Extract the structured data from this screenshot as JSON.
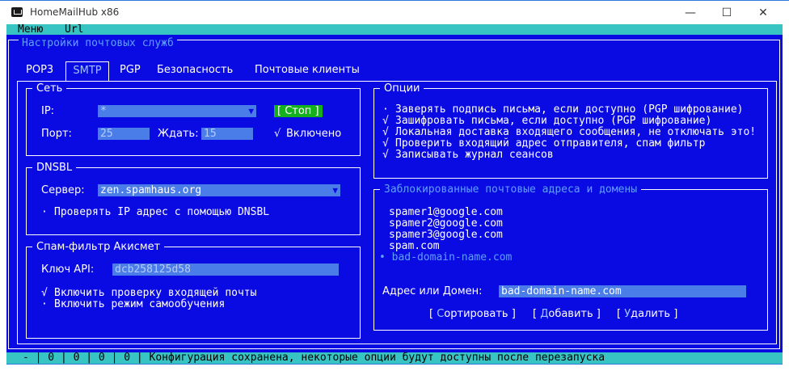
{
  "window": {
    "title": "HomeMailHub x86",
    "minimize_glyph": "—",
    "maximize_glyph": "☐",
    "close_glyph": "✕"
  },
  "menubar": {
    "items": [
      "Меню",
      "Url"
    ]
  },
  "main": {
    "title": "Настройки почтовых служб",
    "tabs": [
      {
        "label": "POP3",
        "active": false
      },
      {
        "label": "SMTP",
        "active": true
      },
      {
        "label": "PGP",
        "active": false
      },
      {
        "label": "Безопасность",
        "active": false
      },
      {
        "label": "Почтовые клиенты",
        "active": false
      }
    ]
  },
  "network": {
    "title": "Сеть",
    "ip_label": "IP:",
    "ip_value": "*",
    "stop_button": "[ Стоп ]",
    "port_label": "Порт:",
    "port_value": "25",
    "wait_label": "Ждать:",
    "wait_value": "15",
    "enabled_mark": "√",
    "enabled_label": "Включено"
  },
  "dnsbl": {
    "title": "DNSBL",
    "server_label": "Сервер:",
    "server_value": "zen.spamhaus.org",
    "check_mark": "·",
    "check_label": "Проверять IP адрес с помощью DNSBL"
  },
  "akismet": {
    "title": "Спам-фильтр Акисмет",
    "api_key_label": "Ключ API:",
    "api_key_value": "dcb258125d58",
    "options": [
      {
        "mark": "√",
        "label": "Включить проверку входящей почты"
      },
      {
        "mark": "·",
        "label": "Включить режим самообучения"
      }
    ]
  },
  "options": {
    "title": "Опции",
    "items": [
      {
        "mark": "·",
        "label": "Заверять подпись письма, если доступно (PGP шифрование)"
      },
      {
        "mark": "√",
        "label": "Зашифровать письма, если доступно (PGP шифрование)"
      },
      {
        "mark": "√",
        "label": "Локальная доставка входящего сообщения, не отключать это!"
      },
      {
        "mark": "√",
        "label": "Проверить входящий адрес отправителя, спам фильтр"
      },
      {
        "mark": "√",
        "label": "Записывать журнал сеансов"
      }
    ]
  },
  "blocked": {
    "title": "Заблокированные почтовые адреса и домены",
    "items": [
      "spamer1@google.com",
      "spamer2@google.com",
      "spamer3@google.com",
      "spam.com",
      "bad-domain-name.com"
    ],
    "selected_index": 4,
    "selected_marker": "•",
    "address_label": "Адрес или Домен:",
    "address_value": "bad-domain-name.com",
    "sort_button": {
      "open": "[ ",
      "hotkey": "С",
      "rest": "ортировать",
      "close": " ]"
    },
    "add_button": {
      "open": "[ ",
      "hotkey": "Д",
      "rest": "обавить",
      "close": " ]"
    },
    "delete_button": {
      "open": "[ ",
      "hotkey": "У",
      "rest": "далить",
      "close": " ]"
    }
  },
  "statusbar": {
    "text": "-  | 0 | 0 | 0 | 0 | Конфигурация сохранена, некоторые опции будут доступны после перезапуска"
  },
  "colors": {
    "background": "#0a0ae3",
    "menubar": "#39c4c4",
    "field": "#4a7de8",
    "dim_text": "#5fa0ff",
    "stop_button": "#14b01e"
  }
}
